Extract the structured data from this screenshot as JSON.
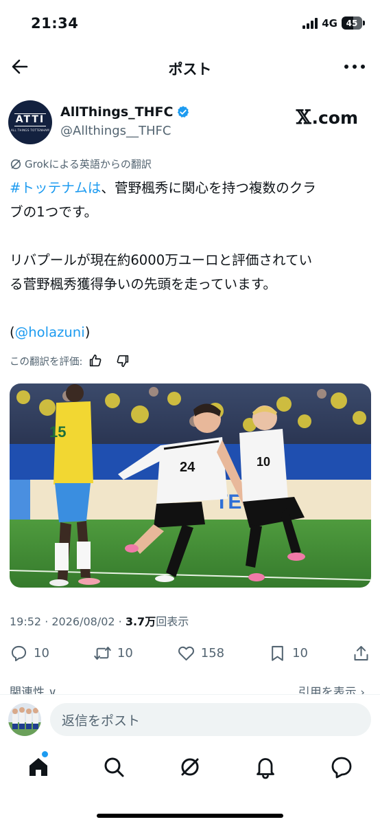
{
  "status_bar": {
    "time": "21:34",
    "network": "4G",
    "battery": "45"
  },
  "header": {
    "title": "ポスト",
    "back_icon": "arrow-left-icon",
    "more_icon": "more-horizontal-icon"
  },
  "author": {
    "avatar_text": "ATTI",
    "avatar_subtext": "ALL THINGS TOTTENHAM",
    "display_name": "AllThings_THFC",
    "handle": "@Allthings__THFC",
    "verified_color": "#1d9bf0",
    "watermark": "X.com"
  },
  "post": {
    "grok_label": "Grokによる英語からの翻訳",
    "line1_hashtag": "#トッテナムは",
    "line1_rest": "、菅野楓秀に関心を持つ複数のクラ",
    "line2": "ブの1つです。",
    "line3": "リバプールが現在約6000万ユーロと評価されてい",
    "line4": "る菅野楓秀獲得争いの先頭を走っています。",
    "line5_open": "(",
    "line5_mention": "@holazuni",
    "line5_close": ")",
    "rate_label": "この翻訳を評価:",
    "timestamp": "19:52 · 2026/08/02 · ",
    "views_count": "3.7万",
    "views_label": "回表示"
  },
  "media": {
    "description_icon": "photo-icon",
    "jersey_numbers": [
      "15",
      "24",
      "10"
    ]
  },
  "actions": {
    "replies": "10",
    "reposts": "10",
    "likes": "158",
    "bookmarks": "10"
  },
  "partial_row": {
    "left": "関連性 ∨",
    "right": "引用を表示 ›"
  },
  "reply_bar": {
    "placeholder": "返信をポスト"
  },
  "colors": {
    "accent": "#1d9bf0",
    "text": "#0f1419",
    "secondary": "#536471"
  }
}
